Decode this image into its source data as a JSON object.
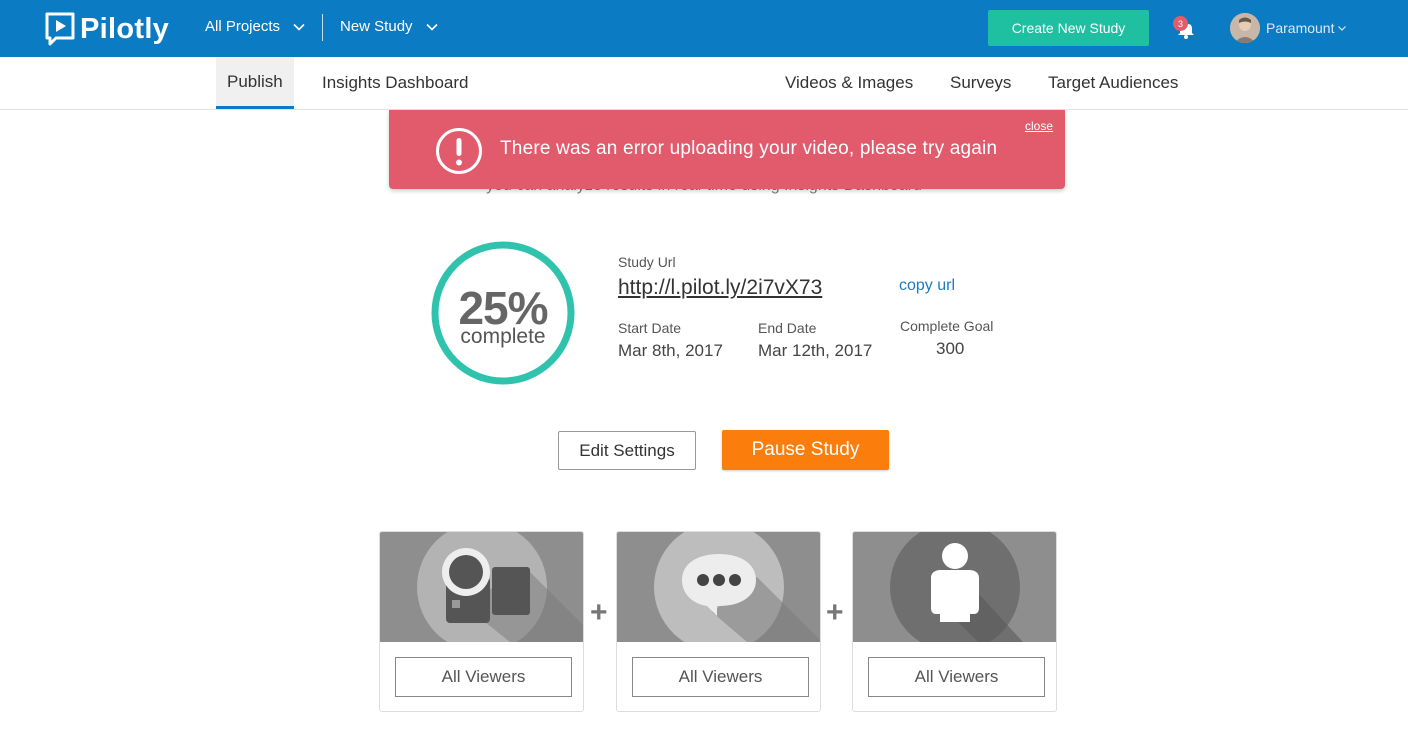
{
  "topbar": {
    "logo_text": "Pilotly",
    "projects_label": "All Projects",
    "study_label": "New Study",
    "create_button": "Create New Study",
    "notification_count": "3",
    "user_name": "Paramount",
    "bar_color": "#0b7bc4",
    "create_color": "#1fbfa2"
  },
  "subnav": {
    "tabs_left": [
      "Publish",
      "Insights Dashboard"
    ],
    "tabs_right": [
      "Videos & Images",
      "Surveys",
      "Target Audiences"
    ],
    "active": "Publish"
  },
  "error": {
    "message": "There was an error uploading your video, please try again",
    "close_label": "close",
    "color": "#e15b6d"
  },
  "hidden_text": "you can analyze results in real-time using Insights Dashboard",
  "study": {
    "progress_value": 25,
    "progress_text": "25%",
    "progress_label": "complete",
    "url_label": "Study Url",
    "url": "http://l.pilot.ly/2i7vX73",
    "copy_label": "copy url",
    "start_label": "Start Date",
    "start_value": "Mar 8th, 2017",
    "end_label": "End Date",
    "end_value": "Mar 12th, 2017",
    "goal_label": "Complete Goal",
    "goal_value": "300"
  },
  "actions": {
    "edit_label": "Edit Settings",
    "pause_label": "Pause Study",
    "pause_color": "#fb7e0c"
  },
  "cards": [
    {
      "icon": "video-camera-icon",
      "select_value": "All Viewers"
    },
    {
      "icon": "chat-bubble-icon",
      "select_value": "All Viewers"
    },
    {
      "icon": "person-icon",
      "select_value": "All Viewers"
    }
  ],
  "plus_symbol": "+"
}
